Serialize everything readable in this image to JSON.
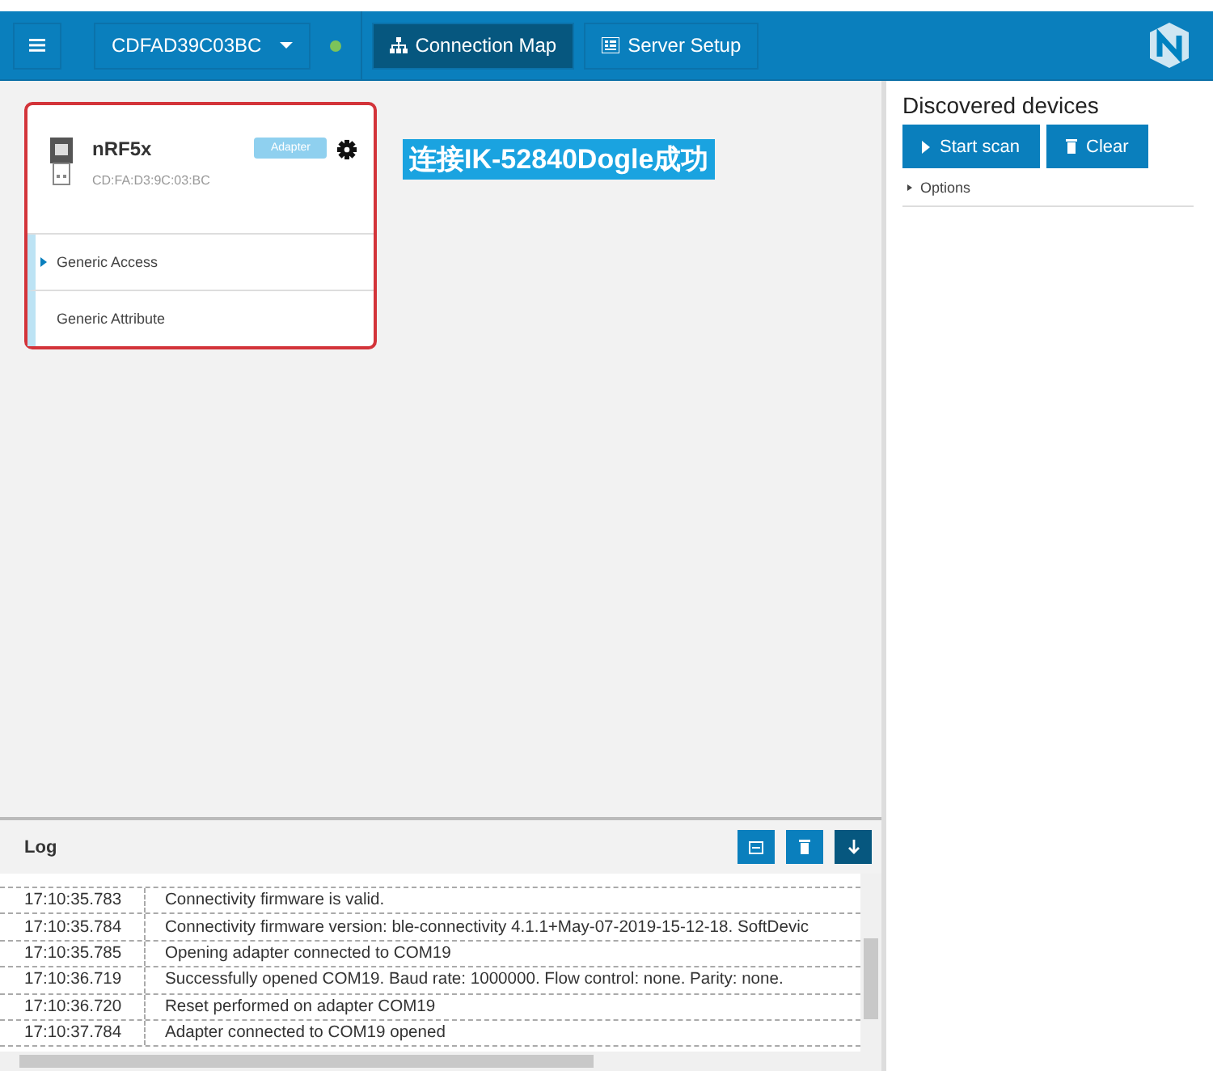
{
  "navbar": {
    "device": "CDFAD39C03BC",
    "connected": true,
    "tabs": [
      {
        "label": "Connection Map",
        "selected": true
      },
      {
        "label": "Server Setup",
        "selected": false
      }
    ]
  },
  "adapter": {
    "name": "nRF5x",
    "address": "CD:FA:D3:9C:03:BC",
    "badge": "Adapter",
    "services": [
      {
        "name": "Generic Access",
        "kind": "collapsed"
      },
      {
        "name": "Generic Attribute",
        "kind": "plain"
      }
    ]
  },
  "caption": "连接IK-52840Dogle成功",
  "discovered": {
    "title": "Discovered devices",
    "buttons": [
      {
        "label": "Start scan"
      },
      {
        "label": "Clear"
      }
    ],
    "options": "Options"
  },
  "log": {
    "title": "Log",
    "entries": [
      {
        "time": "17:10:35.783",
        "message": "Connectivity firmware is valid."
      },
      {
        "time": "17:10:35.784",
        "message": "Connectivity firmware version: ble-connectivity 4.1.1+May-07-2019-15-12-18. SoftDevic"
      },
      {
        "time": "17:10:35.785",
        "message": "Opening adapter connected to COM19"
      },
      {
        "time": "17:10:36.719",
        "message": "Successfully opened COM19. Baud rate: 1000000. Flow control: none. Parity: none."
      },
      {
        "time": "17:10:36.720",
        "message": "Reset performed on adapter COM19"
      },
      {
        "time": "17:10:37.784",
        "message": "Adapter connected to COM19 opened"
      }
    ]
  }
}
